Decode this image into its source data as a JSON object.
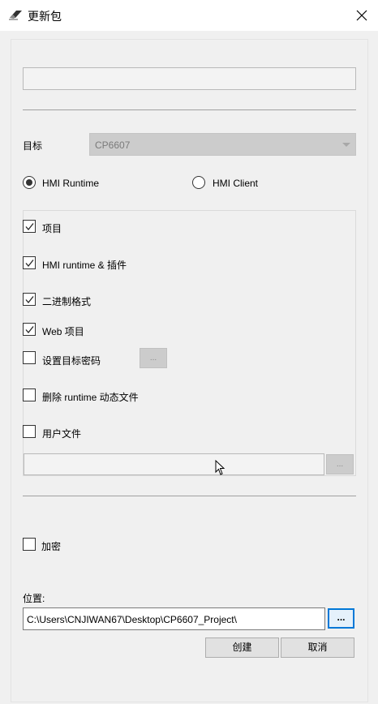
{
  "window": {
    "title": "更新包",
    "icon": "eraser-icon",
    "close_icon": "close-icon"
  },
  "target": {
    "label": "目标",
    "value": "CP6607"
  },
  "runtime_options": [
    {
      "label": "HMI Runtime",
      "checked": true
    },
    {
      "label": "HMI Client",
      "checked": false
    }
  ],
  "options": [
    {
      "label": "项目",
      "checked": true
    },
    {
      "label": "HMI runtime & 插件",
      "checked": true
    },
    {
      "label": "二进制格式",
      "checked": true
    },
    {
      "label": "Web 项目",
      "checked": true
    },
    {
      "label": "设置目标密码",
      "checked": false
    },
    {
      "label": "删除 runtime 动态文件",
      "checked": false
    },
    {
      "label": "用户文件",
      "checked": false
    }
  ],
  "password_button": "...",
  "userfile_browse": "...",
  "encrypt": {
    "label": "加密",
    "checked": false
  },
  "location": {
    "label": "位置:",
    "value": "C:\\Users\\CNJIWAN67\\Desktop\\CP6607_Project\\",
    "browse": "..."
  },
  "buttons": {
    "create": "创建",
    "cancel": "取消"
  }
}
